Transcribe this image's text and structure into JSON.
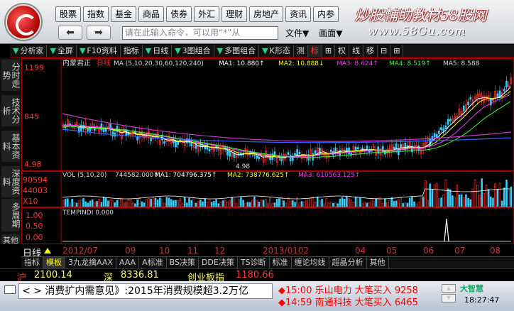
{
  "menu": [
    "股票",
    "指数",
    "基金",
    "商品",
    "债券",
    "外汇",
    "理财",
    "房地产",
    "资讯",
    "内参"
  ],
  "watermark": {
    "title": "炒股輔助教材58股网",
    "url": "www.58Gu.com"
  },
  "command_placeholder": "请在此输入命令，可以用“*”从",
  "file_menu": [
    "文件▼",
    "画面▼"
  ],
  "toolbar": [
    {
      "label": "分析家",
      "arrow": false
    },
    {
      "label": "全屏",
      "arrow": true
    },
    {
      "label": "F10资料",
      "arrow": true
    },
    {
      "label": "指标",
      "arrow": false
    },
    {
      "label": "日线",
      "arrow": true
    },
    {
      "label": "3图组合",
      "arrow": true
    },
    {
      "label": "多图组合",
      "arrow": true
    },
    {
      "label": "K形态",
      "arrow": true
    },
    {
      "label": "测",
      "arrow": false
    },
    {
      "label": "标",
      "arrow": false
    },
    {
      "label": "⊞",
      "arrow": false
    },
    {
      "label": "权",
      "arrow": false
    },
    {
      "label": "线",
      "arrow": false
    },
    {
      "label": "移",
      "arrow": false
    },
    {
      "label": "⊟",
      "arrow": false
    },
    {
      "label": "⊞",
      "arrow": false
    }
  ],
  "vtabs": [
    "分时走势",
    "技术分析",
    "基本资料",
    "深度资料",
    "多周期",
    "其他"
  ],
  "stock_name": "内蒙君正",
  "period": "日线",
  "ma_line": {
    "prefix": "MA (5,10,20,30,60,120,240)",
    "items": [
      "MA1: 10.880↑",
      "MA2: 10.888↓",
      "MA3: 8.624↑",
      "MA4: 8.519↑",
      "MA5: 8.588"
    ]
  },
  "price_axis": [
    "1199",
    "845",
    "4.98"
  ],
  "low_label": "4.98",
  "vol_line": {
    "prefix": "VOL (5,10,20)",
    "items": [
      "744582.000↑",
      "MA1: 704796.375↑",
      "MA2: 738776.625↑",
      "MA3: 610563.125↑"
    ]
  },
  "vol_axis": [
    "90594",
    "44003",
    "X10"
  ],
  "temp_line": "TEMPINDI 0.000",
  "temp_axis": [
    "1.00",
    "0.50",
    "0.00"
  ],
  "day_label": "日线",
  "dates": [
    "2012/07",
    "09",
    "10",
    "11",
    "12",
    "2013/0102",
    "04",
    "05",
    "06",
    "07",
    "08"
  ],
  "bottom_tabs": [
    "指标",
    "模板",
    "3九龙擒AAX",
    "AAA",
    "A标准",
    "BS决策",
    "DDE决策",
    "TS诊断",
    "标准",
    "缠论均线",
    "超晶分析",
    "其他"
  ],
  "indexes": [
    {
      "name": "沪",
      "value": "2100.14",
      "name_color": "#ff3333",
      "color": "#ffff66"
    },
    {
      "name": "深",
      "value": "8336.81",
      "name_color": "#ffff66",
      "color": "#ffff66"
    },
    {
      "name": "创业板指",
      "value": "1180.66",
      "name_color": "#ffff66",
      "color": "#ff3333"
    }
  ],
  "news": "消费扩内需意见》:2015年消费规模超3.2万亿",
  "ticker": [
    {
      "text": "15:00 乐山电力 大笔买入 9258"
    },
    {
      "text": "14:59 南通科技 大笔买入 6465"
    }
  ],
  "brand": "大智慧",
  "clock": "18:27:47",
  "chart_data": {
    "type": "line",
    "title": "",
    "series_note": "candlestick daily price with moving averages"
  }
}
